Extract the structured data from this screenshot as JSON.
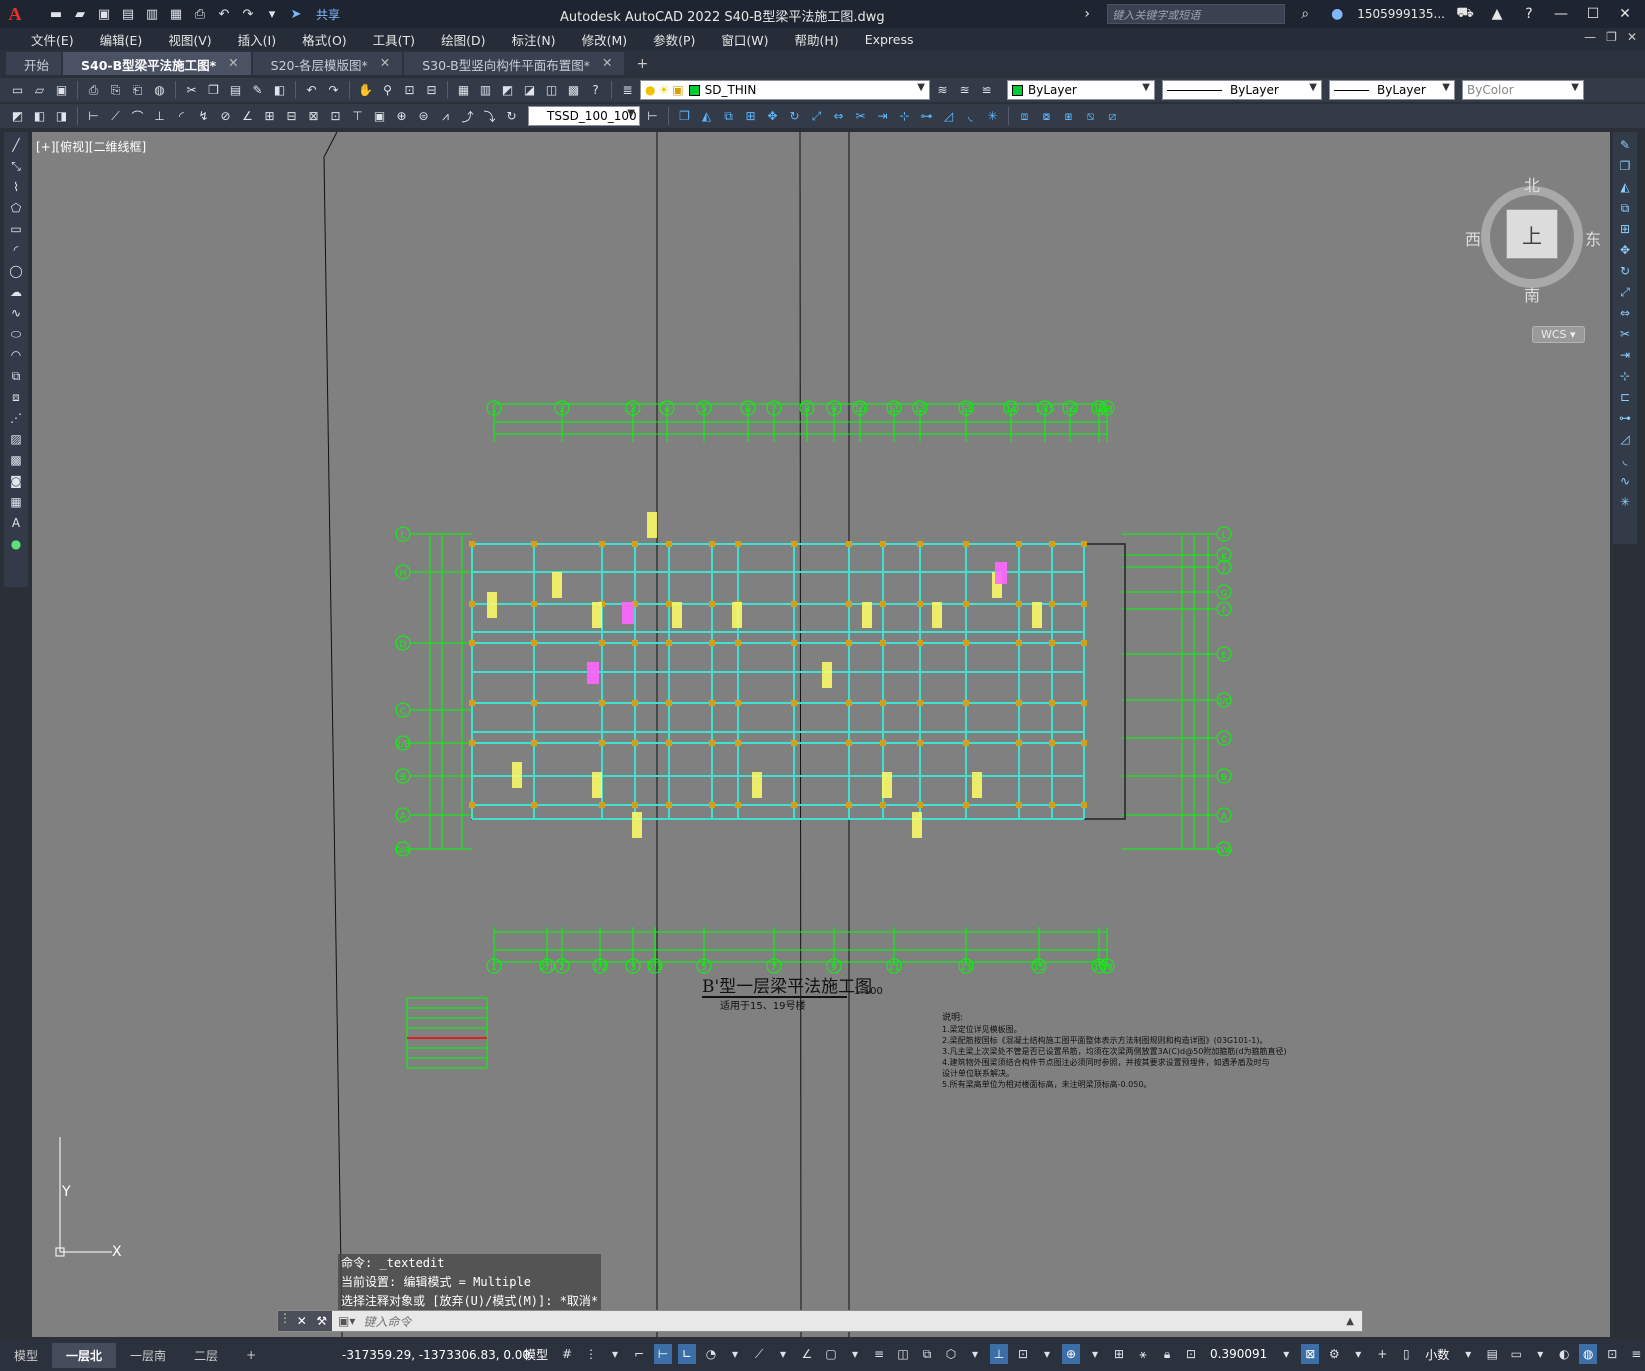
{
  "window": {
    "app_icon": "A",
    "title": "Autodesk AutoCAD 2022    S40-B型梁平法施工图.dwg",
    "search_placeholder": "键入关键字或短语",
    "user": "1505999135...",
    "share": "共享"
  },
  "menu": [
    "文件(E)",
    "编辑(E)",
    "视图(V)",
    "插入(I)",
    "格式(O)",
    "工具(T)",
    "绘图(D)",
    "标注(N)",
    "修改(M)",
    "参数(P)",
    "窗口(W)",
    "帮助(H)",
    "Express"
  ],
  "tabs": [
    {
      "label": "开始",
      "active": false,
      "closable": false
    },
    {
      "label": "S40-B型梁平法施工图*",
      "active": true,
      "closable": true
    },
    {
      "label": "S20-各层模版图*",
      "active": false,
      "closable": true
    },
    {
      "label": "S30-B型竖向构件平面布置图*",
      "active": false,
      "closable": true
    }
  ],
  "toolbar": {
    "layer": "SD_THIN",
    "color": "ByLayer",
    "linetype": "ByLayer",
    "lineweight": "ByLayer",
    "plotstyle": "ByColor",
    "textstyle": "TSSD_100_100"
  },
  "viewport": {
    "label": "[+][俯视][二维线框]",
    "viewcube": {
      "north": "北",
      "south": "南",
      "east": "东",
      "west": "西",
      "face": "上"
    },
    "wcs": "WCS"
  },
  "drawing": {
    "title": "B'型一层梁平法施工图",
    "scale": "1:100",
    "subtitle": "适用于15、19号楼",
    "axes_top": [
      "1",
      "2",
      "3",
      "4",
      "5",
      "6",
      "7",
      "8",
      "9",
      "10",
      "11",
      "12",
      "13",
      "14",
      "1/15",
      "16",
      "17",
      "18"
    ],
    "axes_bottom": [
      "1",
      "2/1",
      "2",
      "1/2",
      "3",
      "2/3",
      "5",
      "7",
      "9",
      "11",
      "13",
      "15",
      "17",
      "18"
    ],
    "axes_left": [
      "L",
      "H",
      "D",
      "C",
      "2/B",
      "B",
      "A",
      "0/A"
    ],
    "axes_right": [
      "L",
      "K",
      "J",
      "G",
      "F",
      "E",
      "2/C",
      "C",
      "B",
      "A",
      "0/A"
    ],
    "notes_title": "说明:",
    "notes": [
      "1.梁定位详见模板图。",
      "2.梁配筋按国标《混凝土结构施工图平面整体表示方法制图规则和构造详图》(03G101-1)。",
      "3.凡主梁上次梁处不管是否已设置吊筋，均须在次梁两侧放置3A(C)d@50附加箍筋(d为箍筋直径)",
      "4.建筑物外围梁须结合构件节点图注必须同时参照，并按其要求设置预埋件，如遇矛盾及时与",
      "设计单位联系解决。",
      "5.所有梁高单位为相对楼面标高，未注明梁顶标高-0.050。"
    ]
  },
  "ucs": {
    "x": "X",
    "y": "Y"
  },
  "command": {
    "history": [
      "命令: _textedit",
      "当前设置: 编辑模式 = Multiple",
      "选择注释对象或 [放弃(U)/模式(M)]: *取消*"
    ],
    "placeholder": "键入命令"
  },
  "layout_tabs": [
    {
      "label": "模型",
      "active": false
    },
    {
      "label": "一层北",
      "active": true
    },
    {
      "label": "一层南",
      "active": false
    },
    {
      "label": "二层",
      "active": false
    }
  ],
  "status": {
    "coords": "-317359.29, -1373306.83, 0.00",
    "model": "模型",
    "scale": "0.390091",
    "units": "小数"
  },
  "colors": {
    "canvas": "#808080",
    "axis_green": "#00ff00",
    "beam_cyan": "#40e0d0",
    "annotation_yellow": "#ffff66",
    "magenta": "#ff66ff",
    "col_orange": "#d4a017"
  }
}
